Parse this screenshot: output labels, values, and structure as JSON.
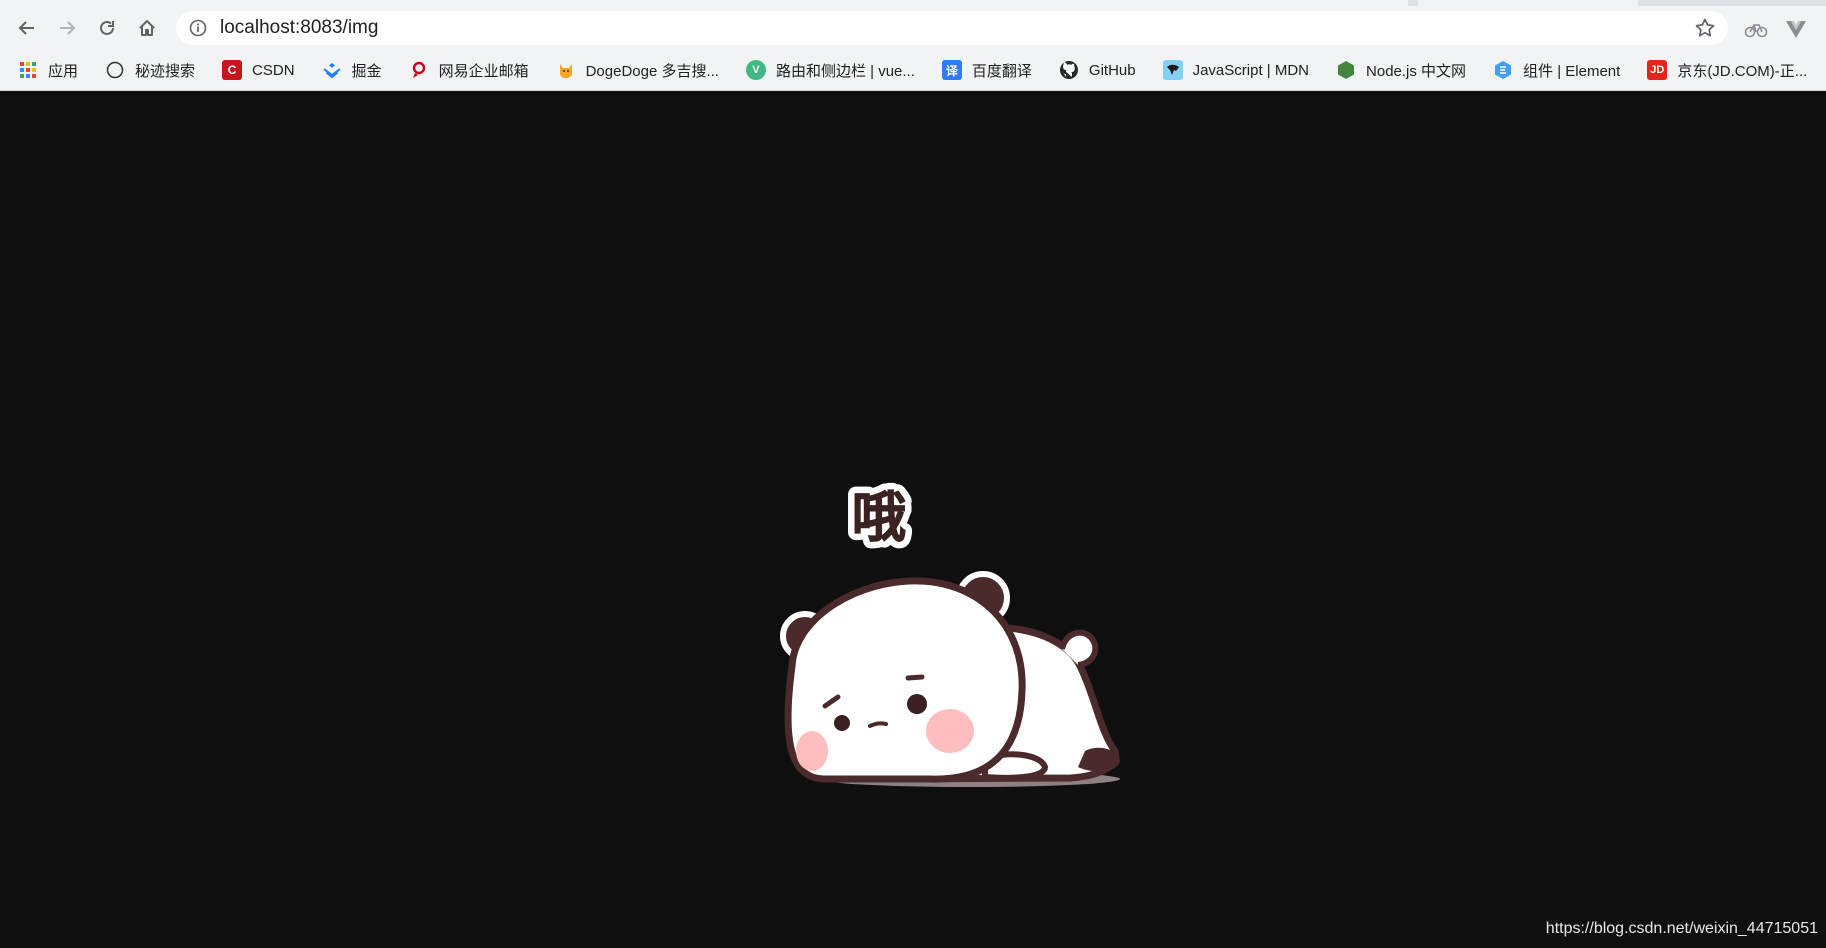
{
  "browser": {
    "url": "localhost:8083/img",
    "bookmarks": [
      {
        "label": "应用",
        "icon": "apps-grid-icon",
        "color": "#4285f4"
      },
      {
        "label": "秘迹搜索",
        "icon": "mijisou-icon",
        "color": "#333333"
      },
      {
        "label": "CSDN",
        "icon": "csdn-icon",
        "color": "#c8161e"
      },
      {
        "label": "掘金",
        "icon": "juejin-icon",
        "color": "#1e80ff"
      },
      {
        "label": "网易企业邮箱",
        "icon": "netease-mail-icon",
        "color": "#d0021b"
      },
      {
        "label": "DogeDoge 多吉搜...",
        "icon": "dogedoge-icon",
        "color": "#f5a623"
      },
      {
        "label": "路由和侧边栏 | vue...",
        "icon": "vue-icon",
        "color": "#41b883"
      },
      {
        "label": "百度翻译",
        "icon": "baidu-translate-icon",
        "color": "#2f7cf6"
      },
      {
        "label": "GitHub",
        "icon": "github-icon",
        "color": "#24292e"
      },
      {
        "label": "JavaScript | MDN",
        "icon": "mdn-icon",
        "color": "#1b5a8a"
      },
      {
        "label": "Node.js 中文网",
        "icon": "nodejs-icon",
        "color": "#43853d"
      },
      {
        "label": "组件 | Element",
        "icon": "element-icon",
        "color": "#409eff"
      },
      {
        "label": "京东(JD.COM)-正...",
        "icon": "jd-icon",
        "color": "#e1251b"
      }
    ]
  },
  "page": {
    "background": "#0f0f0f",
    "sticker_text": "哦",
    "watermark": "https://blog.csdn.net/weixin_44715051"
  }
}
